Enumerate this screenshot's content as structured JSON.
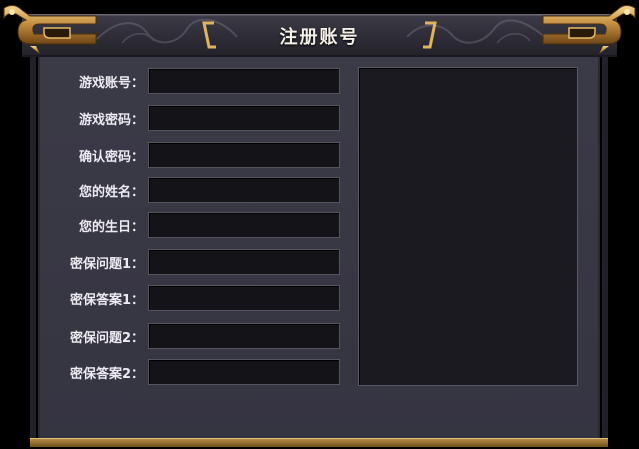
{
  "dialog": {
    "title": "注册账号"
  },
  "form": {
    "fields": [
      {
        "label": "游戏账号：",
        "value": ""
      },
      {
        "label": "游戏密码：",
        "value": ""
      },
      {
        "label": "确认密码：",
        "value": ""
      },
      {
        "label": "您的姓名：",
        "value": ""
      },
      {
        "label": "您的生日：",
        "value": ""
      },
      {
        "label": "密保问题1：",
        "value": ""
      },
      {
        "label": "密保答案1：",
        "value": ""
      },
      {
        "label": "密保问题2：",
        "value": ""
      },
      {
        "label": "密保答案2：",
        "value": ""
      }
    ]
  },
  "colors": {
    "panel": "#3a3946",
    "field": "#141318",
    "gold": "#c9994f",
    "text": "#ecebf2"
  },
  "icons": {
    "left_ornament": "dragon-ornament-left-icon",
    "right_ornament": "dragon-ornament-right-icon",
    "title_brackets": "gold-bracket-icon"
  }
}
